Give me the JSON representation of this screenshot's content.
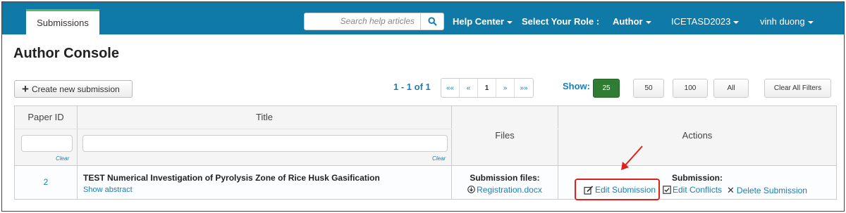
{
  "nav": {
    "tab_label": "Submissions",
    "search_placeholder": "Search help articles",
    "help_center": "Help Center",
    "role_label": "Select Your Role :",
    "role_value": "Author",
    "conference": "ICETASD2023",
    "user": "vinh duong"
  },
  "page": {
    "title": "Author Console"
  },
  "toolbar": {
    "create_label": "Create new submission",
    "range": "1 - 1 of 1",
    "pager": [
      "««",
      "«",
      "1",
      "»",
      "»»"
    ],
    "show_label": "Show:",
    "sizes": [
      "25",
      "50",
      "100",
      "All"
    ],
    "active_size": "25",
    "clear_filters": "Clear All Filters"
  },
  "table": {
    "headers": {
      "paper_id": "Paper ID",
      "title": "Title",
      "files": "Files",
      "actions": "Actions"
    },
    "clear_label": "Clear",
    "rows": [
      {
        "id": "2",
        "title": "TEST Numerical Investigation of Pyrolysis Zone of Rice Husk Gasification",
        "show_abstract": "Show abstract",
        "files_label": "Submission files:",
        "file_name": "Registration.docx",
        "submission_label": "Submission:",
        "actions": [
          "Edit Submission",
          "Edit Conflicts",
          "Delete Submission"
        ]
      }
    ]
  },
  "colors": {
    "nav_bg": "#0f7aa8",
    "link": "#1a7fb5",
    "active_size": "#2e7d32",
    "annotation": "#e0201b"
  }
}
